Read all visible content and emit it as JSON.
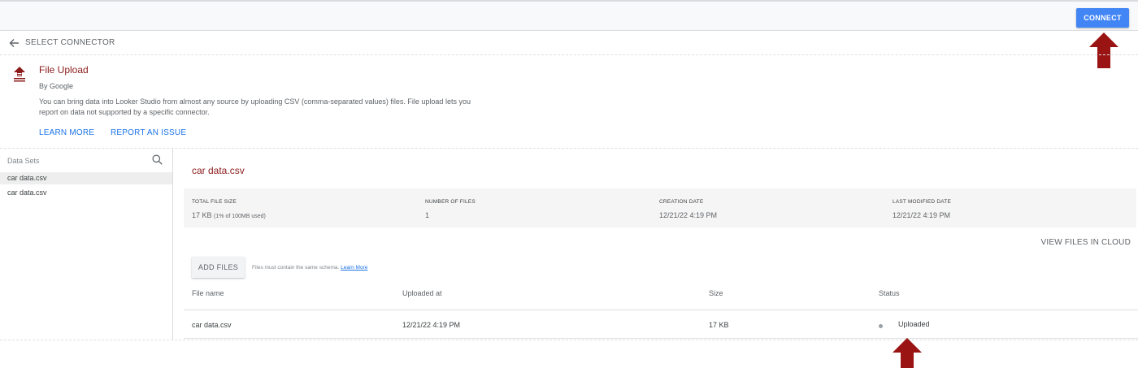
{
  "toolbar": {
    "connect_label": "CONNECT"
  },
  "nav": {
    "select_connector": "SELECT CONNECTOR"
  },
  "connector": {
    "title": "File Upload",
    "by": "By Google",
    "description": "You can bring data into Looker Studio from almost any source by uploading CSV (comma-separated values) files. File upload lets you report on data not supported by a specific connector.",
    "learn_more": "LEARN MORE",
    "report_issue": "REPORT AN ISSUE",
    "icon": "upload-icon"
  },
  "sidebar": {
    "header": "Data Sets",
    "items": [
      {
        "label": "car data.csv"
      },
      {
        "label": "car data.csv"
      }
    ]
  },
  "dataset": {
    "title": "car data.csv",
    "stats": {
      "total_file_size_label": "TOTAL FILE SIZE",
      "total_file_size_value": "17 KB",
      "total_file_size_note": "(1% of 100MB used)",
      "number_of_files_label": "NUMBER OF FILES",
      "number_of_files_value": "1",
      "creation_date_label": "CREATION DATE",
      "creation_date_value": "12/21/22 4:19 PM",
      "last_modified_label": "LAST MODIFIED DATE",
      "last_modified_value": "12/21/22 4:19 PM"
    },
    "view_files": "VIEW FILES IN CLOUD",
    "add_files": "ADD FILES",
    "schema_note": "Files must contain the same schema.",
    "schema_link": "Learn More",
    "table": {
      "headers": [
        "File name",
        "Uploaded at",
        "Size",
        "Status"
      ],
      "rows": [
        {
          "file_name": "car data.csv",
          "uploaded_at": "12/21/22 4:19 PM",
          "size": "17 KB",
          "status": "Uploaded"
        }
      ]
    }
  },
  "colors": {
    "accent": "#4285f4",
    "title_red": "#8b1a1a",
    "annotation_arrow": "#9b1414",
    "link_blue": "#1a73e8"
  }
}
